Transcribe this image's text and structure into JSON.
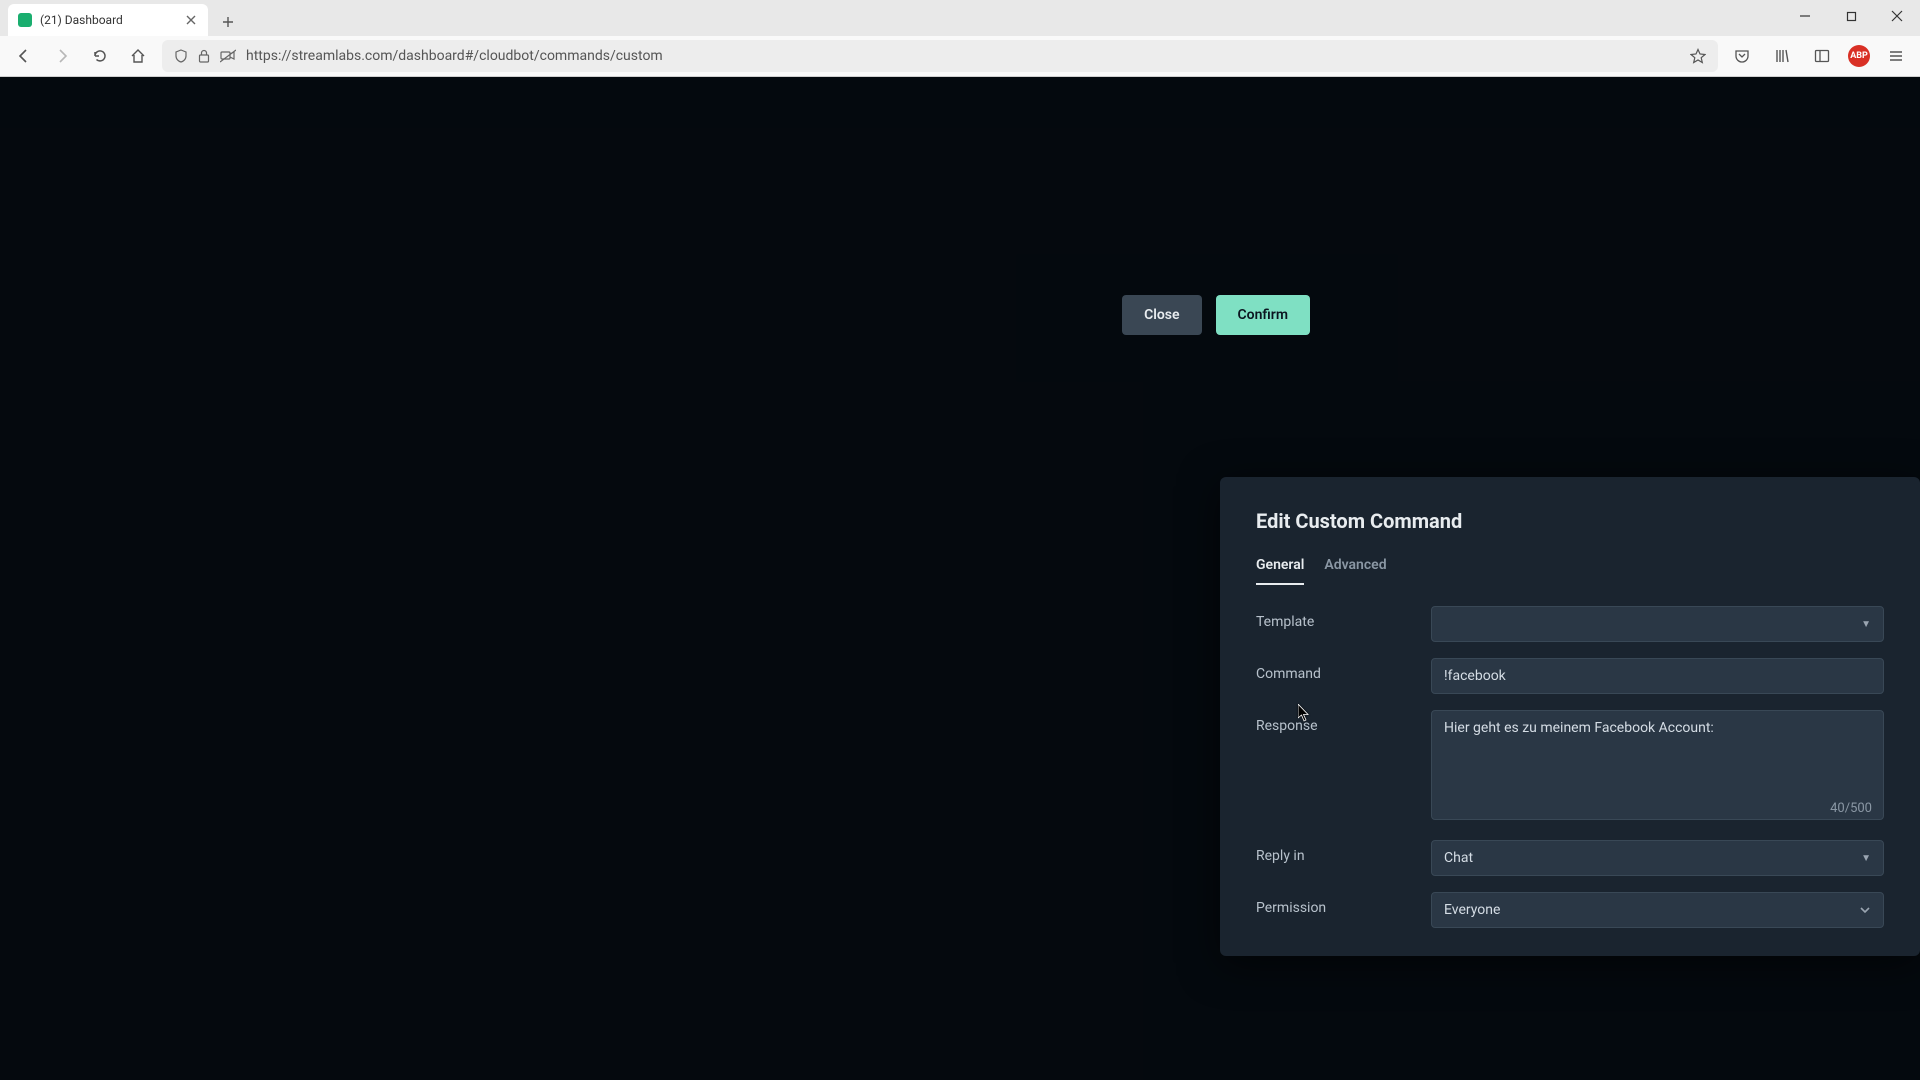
{
  "browser": {
    "tab_title": "(21) Dashboard",
    "url": "https://streamlabs.com/dashboard#/cloudbot/commands/custom",
    "ext_badge": "ABP"
  },
  "modal": {
    "title": "Edit Custom Command",
    "tabs": {
      "general": "General",
      "advanced": "Advanced"
    },
    "labels": {
      "template": "Template",
      "command": "Command",
      "response": "Response",
      "reply_in": "Reply in",
      "permission": "Permission"
    },
    "fields": {
      "template_value": "",
      "command_value": "!facebook",
      "response_value": "Hier geht es zu meinem Facebook Account:",
      "response_counter": "40/500",
      "reply_in_value": "Chat",
      "permission_value": "Everyone"
    },
    "buttons": {
      "close": "Close",
      "confirm": "Confirm"
    }
  }
}
